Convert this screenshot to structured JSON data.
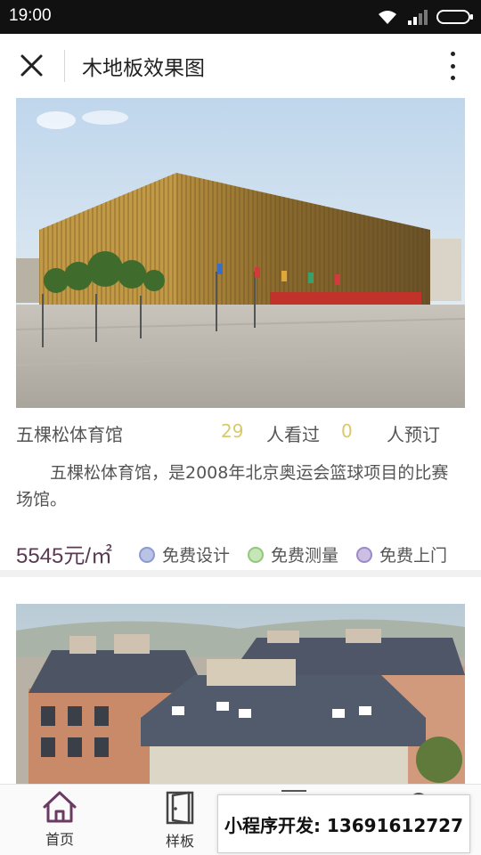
{
  "status_bar": {
    "time": "19:00"
  },
  "header": {
    "title": "木地板效果图"
  },
  "card": {
    "name": "五棵松体育馆",
    "views_count": "29",
    "views_label": "人看过",
    "booked_count": "0",
    "booked_label": "人预订",
    "description": "五棵松体育馆，是2008年北京奥运会篮球项目的比赛场馆。",
    "price": "5545元/㎡",
    "features": [
      "免费设计",
      "免费测量",
      "免费上门"
    ]
  },
  "bottom_nav": {
    "items": [
      {
        "label": "首页",
        "icon": "home-icon"
      },
      {
        "label": "样板",
        "icon": "door-icon"
      }
    ]
  },
  "contact": {
    "text": "小程序开发: 13691612727"
  },
  "colors": {
    "accent": "#6b3a63",
    "count": "#d8c96a",
    "price": "#5a3a52"
  }
}
